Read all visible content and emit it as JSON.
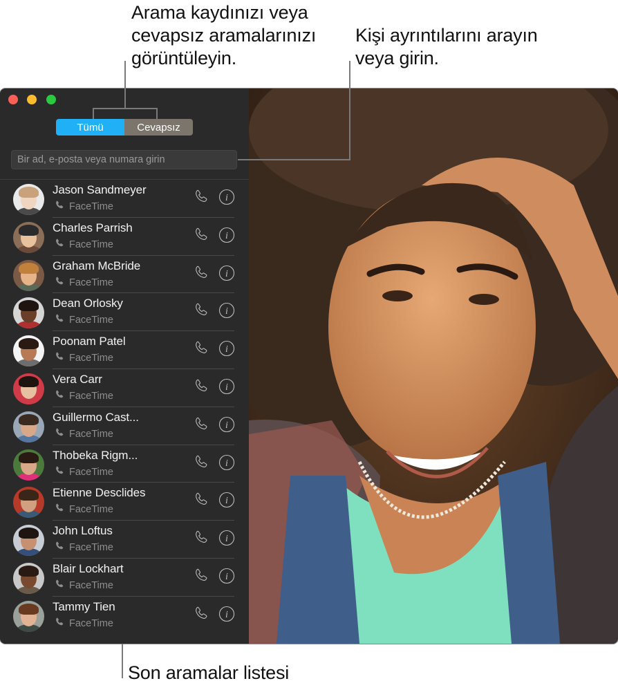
{
  "callouts": {
    "filter": "Arama kaydınızı veya cevapsız aramalarınızı görüntüleyin.",
    "filter_lines": [
      "Arama kaydınızı veya",
      "cevapsız aramalarınızı",
      "görüntüleyin."
    ],
    "search": "Kişi ayrıntılarını arayın veya girin.",
    "search_lines": [
      "Kişi ayrıntılarını arayın",
      "veya girin."
    ],
    "recents": "Son aramalar listesi"
  },
  "window": {
    "traffic_lights": [
      "close",
      "minimize",
      "zoom"
    ],
    "segmented_control": {
      "options": [
        "Tümü",
        "Cevapsız"
      ],
      "selected": "Tümü",
      "active_color": "#1fb0f5"
    },
    "search": {
      "placeholder": "Bir ad, e-posta veya numara girin",
      "value": ""
    },
    "recents": [
      {
        "name": "Jason Sandmeyer",
        "type": "FaceTime",
        "call_icon": "phone-icon",
        "info_icon": "info-icon"
      },
      {
        "name": "Charles Parrish",
        "type": "FaceTime",
        "call_icon": "phone-icon",
        "info_icon": "info-icon"
      },
      {
        "name": "Graham McBride",
        "type": "FaceTime",
        "call_icon": "phone-icon",
        "info_icon": "info-icon"
      },
      {
        "name": "Dean Orlosky",
        "type": "FaceTime",
        "call_icon": "phone-icon",
        "info_icon": "info-icon"
      },
      {
        "name": "Poonam Patel",
        "type": "FaceTime",
        "call_icon": "phone-icon",
        "info_icon": "info-icon"
      },
      {
        "name": "Vera Carr",
        "type": "FaceTime",
        "call_icon": "phone-icon",
        "info_icon": "info-icon"
      },
      {
        "name": "Guillermo Cast...",
        "type": "FaceTime",
        "call_icon": "phone-icon",
        "info_icon": "info-icon"
      },
      {
        "name": "Thobeka Rigm...",
        "type": "FaceTime",
        "call_icon": "phone-icon",
        "info_icon": "info-icon"
      },
      {
        "name": "Etienne Desclides",
        "type": "FaceTime",
        "call_icon": "phone-icon",
        "info_icon": "info-icon"
      },
      {
        "name": "John Loftus",
        "type": "FaceTime",
        "call_icon": "phone-icon",
        "info_icon": "info-icon"
      },
      {
        "name": "Blair Lockhart",
        "type": "FaceTime",
        "call_icon": "phone-icon",
        "info_icon": "info-icon"
      },
      {
        "name": "Tammy Tien",
        "type": "FaceTime",
        "call_icon": "phone-icon",
        "info_icon": "info-icon"
      }
    ],
    "video_preview": "camera-preview"
  }
}
